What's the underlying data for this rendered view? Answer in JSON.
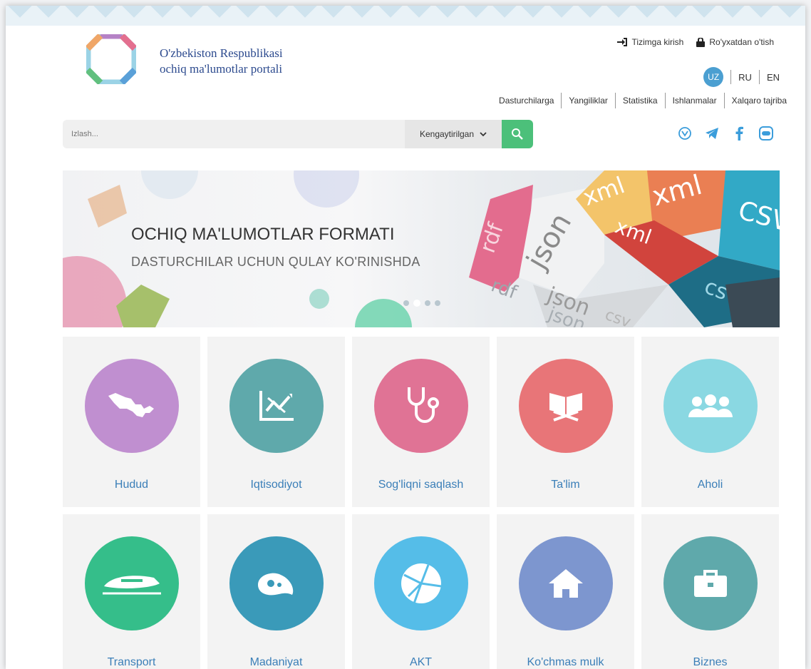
{
  "brand": {
    "line1": "O'zbekiston Respublikasi",
    "line2": "ochiq ma'lumotlar portali"
  },
  "auth": {
    "login": "Tizimga kirish",
    "register": "Ro'yxatdan o'tish"
  },
  "languages": {
    "uz": "UZ",
    "ru": "RU",
    "en": "EN"
  },
  "topnav": [
    "Dasturchilarga",
    "Yangiliklar",
    "Statistika",
    "Ishlanmalar",
    "Xalqaro tajriba"
  ],
  "search": {
    "placeholder": "Izlash...",
    "advanced": "Kengaytirilgan"
  },
  "social": [
    "viber-icon",
    "telegram-icon",
    "facebook-icon",
    "chat-icon"
  ],
  "banner": {
    "title": "OCHIQ MA'LUMOTLAR FORMATI",
    "subtitle": "DASTURCHILAR UCHUN QULAY KO'RINISHDA",
    "cube_labels": [
      "rdf",
      "json",
      "xml",
      "xml",
      "CSV",
      "xml",
      "csv",
      "json",
      "csv",
      "rdf",
      "json"
    ]
  },
  "categories": [
    {
      "label": "Hudud",
      "color": "#c08fd0",
      "icon": "map-icon"
    },
    {
      "label": "Iqtisodiyot",
      "color": "#5fa9ab",
      "icon": "chart-icon"
    },
    {
      "label": "Sog'liqni saqlash",
      "color": "#e07395",
      "icon": "stethoscope-icon"
    },
    {
      "label": "Ta'lim",
      "color": "#e87578",
      "icon": "book-icon"
    },
    {
      "label": "Aholi",
      "color": "#8ad8e2",
      "icon": "people-icon"
    },
    {
      "label": "Transport",
      "color": "#35be8a",
      "icon": "train-icon"
    },
    {
      "label": "Madaniyat",
      "color": "#3a9ab9",
      "icon": "paisley-icon"
    },
    {
      "label": "AKT",
      "color": "#55bde8",
      "icon": "network-icon"
    },
    {
      "label": "Ko'chmas mulk",
      "color": "#7d96cf",
      "icon": "house-icon"
    },
    {
      "label": "Biznes",
      "color": "#5fa9ab",
      "icon": "briefcase-icon"
    }
  ]
}
